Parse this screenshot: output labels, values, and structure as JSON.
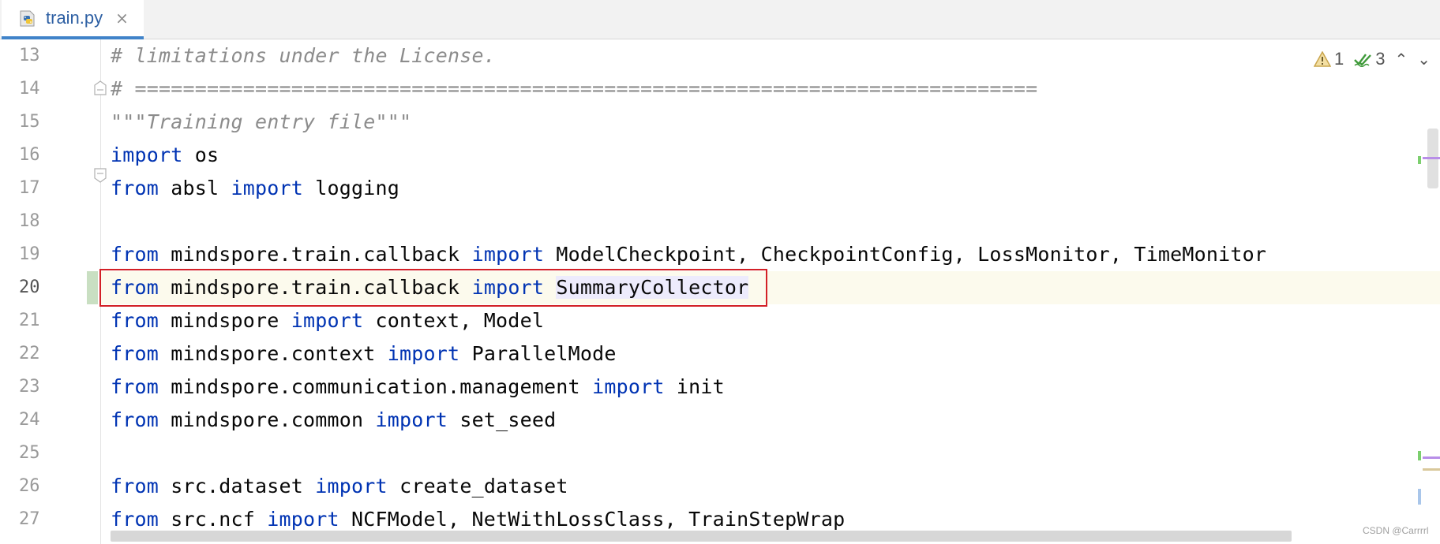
{
  "tab": {
    "title": "train.py",
    "icon": "python-file-icon",
    "close": "×"
  },
  "inspections": {
    "warnings": "1",
    "typos": "3",
    "colors": {
      "warning": "#c9a54d",
      "ok": "#3f9a3a"
    }
  },
  "code": {
    "current_line": 20,
    "lines": [
      {
        "num": "13",
        "text": "# limitations under the License."
      },
      {
        "num": "14",
        "text": "# ==========================================================================="
      },
      {
        "num": "15",
        "text": "\"\"\"Training entry file\"\"\""
      },
      {
        "num": "16",
        "text": "import os"
      },
      {
        "num": "17",
        "text": "from absl import logging"
      },
      {
        "num": "18",
        "text": ""
      },
      {
        "num": "19",
        "text": "from mindspore.train.callback import ModelCheckpoint, CheckpointConfig, LossMonitor, TimeMonitor"
      },
      {
        "num": "20",
        "text": "from mindspore.train.callback import SummaryCollector"
      },
      {
        "num": "21",
        "text": "from mindspore import context, Model"
      },
      {
        "num": "22",
        "text": "from mindspore.context import ParallelMode"
      },
      {
        "num": "23",
        "text": "from mindspore.communication.management import init"
      },
      {
        "num": "24",
        "text": "from mindspore.common import set_seed"
      },
      {
        "num": "25",
        "text": ""
      },
      {
        "num": "26",
        "text": "from src.dataset import create_dataset"
      },
      {
        "num": "27",
        "text": "from src.ncf import NCFModel, NetWithLossClass, TrainStepWrap"
      }
    ]
  },
  "watermark": "CSDN @Carrrrl"
}
